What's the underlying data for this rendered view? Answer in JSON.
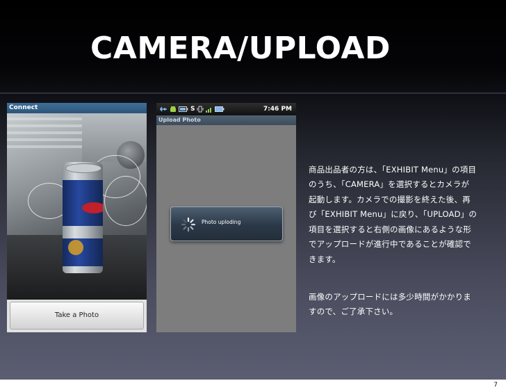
{
  "slide": {
    "title": "CAMERA/UPLOAD",
    "page_number": "7"
  },
  "camera_screen": {
    "title_bar": "Connect",
    "take_photo_button": "Take a Photo"
  },
  "upload_screen": {
    "status_time": "7:46 PM",
    "status_icons": [
      "usb-icon",
      "android-debug-icon",
      "battery-icon",
      "s-app-icon",
      "vibrate-icon",
      "signal-icon",
      "battery-full-icon"
    ],
    "title_bar": "Upload Photo",
    "dialog_message": "Photo uploding"
  },
  "description": {
    "paragraph1": "商品出品者の方は、「EXHIBIT Menu」の項目\nのうち、「CAMERA」を選択するとカメラが\n起動します。カメラでの撮影を終えた後、再\nび「EXHIBIT Menu」に戻り、「UPLOAD」の\n項目を選択すると右側の画像にあるような形\nでアップロードが進行中であることが確認で\nきます。",
    "paragraph2": "画像のアップロードには多少時間がかかりま\nすので、ご了承下さい。"
  }
}
